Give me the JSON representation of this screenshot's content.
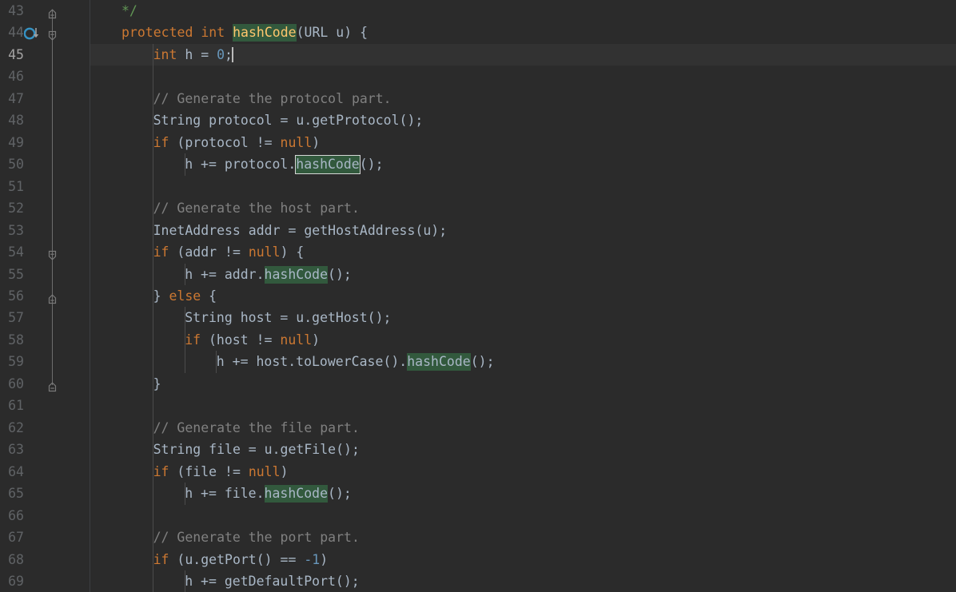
{
  "editor": {
    "theme": "darcula",
    "language": "java",
    "colors": {
      "background": "#2b2b2b",
      "caret_line_background": "#323232",
      "default_text": "#a9b7c6",
      "line_number": "#606366",
      "line_number_current": "#a4a3a3",
      "keyword": "#cc7832",
      "number": "#6897bb",
      "line_comment": "#808080",
      "javadoc_comment": "#629755",
      "method_declaration": "#ffc66d",
      "occurrence_highlight": "#32593d",
      "occurrence_current_border": "#d6d6d6",
      "gutter_marker_blue": "#3592c4",
      "indent_guide": "#4b4b4b",
      "fold_ribbon": "#6e6e6e",
      "caret": "#bbbbbb"
    },
    "first_visible_line": 43,
    "current_line": 45,
    "caret_column_text": "int h = 0;",
    "search_term": "hashCode",
    "occurrence_count": 5
  },
  "gutter": {
    "markers": [
      {
        "line": 44,
        "icon": "overriding-method-icon",
        "tooltip_name": "overrides-marker"
      }
    ],
    "fold_markers": [
      {
        "line": 43,
        "type": "fold-end-up"
      },
      {
        "line": 44,
        "type": "fold-start-down"
      },
      {
        "line": 54,
        "type": "fold-start-down"
      },
      {
        "line": 56,
        "type": "fold-end-up"
      },
      {
        "line": 60,
        "type": "fold-end-up"
      }
    ]
  },
  "lines": [
    {
      "number": 43,
      "indent": 1,
      "tokens": [
        {
          "t": "*/",
          "c": "jdoc"
        }
      ]
    },
    {
      "number": 44,
      "indent": 1,
      "tokens": [
        {
          "t": "protected",
          "c": "kw"
        },
        {
          "t": " ",
          "c": "punct"
        },
        {
          "t": "int",
          "c": "kw"
        },
        {
          "t": " ",
          "c": "punct"
        },
        {
          "t": "hashCode",
          "c": "methodname",
          "hl": "occ"
        },
        {
          "t": "(",
          "c": "punct"
        },
        {
          "t": "URL",
          "c": "type"
        },
        {
          "t": " u",
          "c": "ident"
        },
        {
          "t": ") {",
          "c": "punct"
        }
      ]
    },
    {
      "number": 45,
      "indent": 2,
      "current": true,
      "tokens": [
        {
          "t": "int",
          "c": "kw"
        },
        {
          "t": " h = ",
          "c": "ident"
        },
        {
          "t": "0",
          "c": "num"
        },
        {
          "t": ";",
          "c": "punct"
        },
        {
          "t": "",
          "c": "caret"
        }
      ]
    },
    {
      "number": 46,
      "indent": 0,
      "tokens": []
    },
    {
      "number": 47,
      "indent": 2,
      "tokens": [
        {
          "t": "// Generate the protocol part.",
          "c": "cmt"
        }
      ]
    },
    {
      "number": 48,
      "indent": 2,
      "tokens": [
        {
          "t": "String",
          "c": "type"
        },
        {
          "t": " protocol = u.getProtocol();",
          "c": "ident"
        }
      ]
    },
    {
      "number": 49,
      "indent": 2,
      "tokens": [
        {
          "t": "if",
          "c": "kw"
        },
        {
          "t": " (protocol != ",
          "c": "ident"
        },
        {
          "t": "null",
          "c": "kw"
        },
        {
          "t": ")",
          "c": "punct"
        }
      ]
    },
    {
      "number": 50,
      "indent": 3,
      "tokens": [
        {
          "t": "h += protocol.",
          "c": "ident"
        },
        {
          "t": "hashCode",
          "c": "ident",
          "hl": "occ-cur"
        },
        {
          "t": "();",
          "c": "punct"
        }
      ]
    },
    {
      "number": 51,
      "indent": 0,
      "tokens": []
    },
    {
      "number": 52,
      "indent": 2,
      "tokens": [
        {
          "t": "// Generate the host part.",
          "c": "cmt"
        }
      ]
    },
    {
      "number": 53,
      "indent": 2,
      "tokens": [
        {
          "t": "InetAddress",
          "c": "type"
        },
        {
          "t": " addr = getHostAddress(u);",
          "c": "ident"
        }
      ]
    },
    {
      "number": 54,
      "indent": 2,
      "tokens": [
        {
          "t": "if",
          "c": "kw"
        },
        {
          "t": " (addr != ",
          "c": "ident"
        },
        {
          "t": "null",
          "c": "kw"
        },
        {
          "t": ") {",
          "c": "punct"
        }
      ]
    },
    {
      "number": 55,
      "indent": 3,
      "tokens": [
        {
          "t": "h += addr.",
          "c": "ident"
        },
        {
          "t": "hashCode",
          "c": "ident",
          "hl": "occ"
        },
        {
          "t": "();",
          "c": "punct"
        }
      ]
    },
    {
      "number": 56,
      "indent": 2,
      "tokens": [
        {
          "t": "} ",
          "c": "punct"
        },
        {
          "t": "else",
          "c": "kw"
        },
        {
          "t": " {",
          "c": "punct"
        }
      ]
    },
    {
      "number": 57,
      "indent": 3,
      "tokens": [
        {
          "t": "String",
          "c": "type"
        },
        {
          "t": " host = u.getHost();",
          "c": "ident"
        }
      ]
    },
    {
      "number": 58,
      "indent": 3,
      "tokens": [
        {
          "t": "if",
          "c": "kw"
        },
        {
          "t": " (host != ",
          "c": "ident"
        },
        {
          "t": "null",
          "c": "kw"
        },
        {
          "t": ")",
          "c": "punct"
        }
      ]
    },
    {
      "number": 59,
      "indent": 4,
      "tokens": [
        {
          "t": "h += host.toLowerCase().",
          "c": "ident"
        },
        {
          "t": "hashCode",
          "c": "ident",
          "hl": "occ"
        },
        {
          "t": "();",
          "c": "punct"
        }
      ]
    },
    {
      "number": 60,
      "indent": 2,
      "tokens": [
        {
          "t": "}",
          "c": "punct"
        }
      ]
    },
    {
      "number": 61,
      "indent": 0,
      "tokens": []
    },
    {
      "number": 62,
      "indent": 2,
      "tokens": [
        {
          "t": "// Generate the file part.",
          "c": "cmt"
        }
      ]
    },
    {
      "number": 63,
      "indent": 2,
      "tokens": [
        {
          "t": "String",
          "c": "type"
        },
        {
          "t": " file = u.getFile();",
          "c": "ident"
        }
      ]
    },
    {
      "number": 64,
      "indent": 2,
      "tokens": [
        {
          "t": "if",
          "c": "kw"
        },
        {
          "t": " (file != ",
          "c": "ident"
        },
        {
          "t": "null",
          "c": "kw"
        },
        {
          "t": ")",
          "c": "punct"
        }
      ]
    },
    {
      "number": 65,
      "indent": 3,
      "tokens": [
        {
          "t": "h += file.",
          "c": "ident"
        },
        {
          "t": "hashCode",
          "c": "ident",
          "hl": "occ"
        },
        {
          "t": "();",
          "c": "punct"
        }
      ]
    },
    {
      "number": 66,
      "indent": 0,
      "tokens": []
    },
    {
      "number": 67,
      "indent": 2,
      "tokens": [
        {
          "t": "// Generate the port part.",
          "c": "cmt"
        }
      ]
    },
    {
      "number": 68,
      "indent": 2,
      "tokens": [
        {
          "t": "if",
          "c": "kw"
        },
        {
          "t": " (u.getPort() == ",
          "c": "ident"
        },
        {
          "t": "-1",
          "c": "num"
        },
        {
          "t": ")",
          "c": "punct"
        }
      ]
    },
    {
      "number": 69,
      "indent": 3,
      "tokens": [
        {
          "t": "h += getDefaultPort();",
          "c": "ident"
        }
      ]
    }
  ]
}
